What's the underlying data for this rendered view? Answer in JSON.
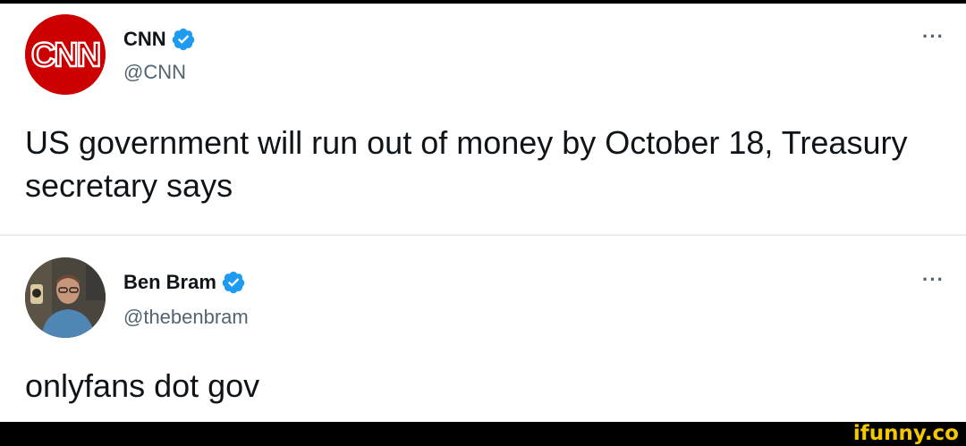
{
  "tweets": [
    {
      "name": "CNN",
      "handle": "@CNN",
      "text": "US government will run out of money by October 18, Treasury secretary says",
      "avatar_logo": "CNN",
      "verified": true,
      "more_label": "···"
    },
    {
      "name": "Ben Bram",
      "handle": "@thebenbram",
      "text": "onlyfans dot gov",
      "verified": true,
      "more_label": "···"
    }
  ],
  "watermark": "ifunny.co",
  "colors": {
    "verified_blue": "#1d9bf0",
    "cnn_red": "#cc0000",
    "watermark_yellow": "#f5c700"
  },
  "icons": [
    "cnn-logo-icon",
    "verified-badge-icon",
    "more-options-icon",
    "profile-photo"
  ]
}
